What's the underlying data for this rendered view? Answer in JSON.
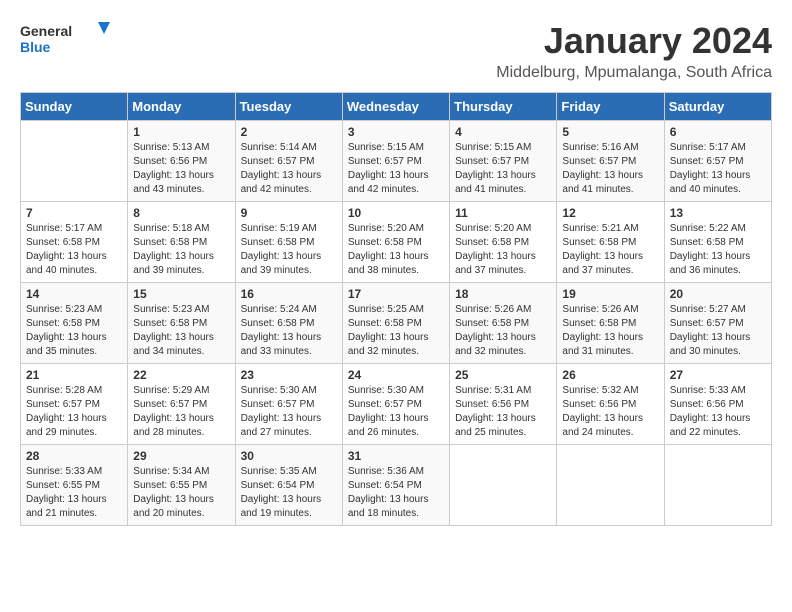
{
  "header": {
    "logo_general": "General",
    "logo_blue": "Blue",
    "month_title": "January 2024",
    "location": "Middelburg, Mpumalanga, South Africa"
  },
  "weekdays": [
    "Sunday",
    "Monday",
    "Tuesday",
    "Wednesday",
    "Thursday",
    "Friday",
    "Saturday"
  ],
  "weeks": [
    [
      {
        "day": "",
        "sunrise": "",
        "sunset": "",
        "daylight": ""
      },
      {
        "day": "1",
        "sunrise": "Sunrise: 5:13 AM",
        "sunset": "Sunset: 6:56 PM",
        "daylight": "Daylight: 13 hours and 43 minutes."
      },
      {
        "day": "2",
        "sunrise": "Sunrise: 5:14 AM",
        "sunset": "Sunset: 6:57 PM",
        "daylight": "Daylight: 13 hours and 42 minutes."
      },
      {
        "day": "3",
        "sunrise": "Sunrise: 5:15 AM",
        "sunset": "Sunset: 6:57 PM",
        "daylight": "Daylight: 13 hours and 42 minutes."
      },
      {
        "day": "4",
        "sunrise": "Sunrise: 5:15 AM",
        "sunset": "Sunset: 6:57 PM",
        "daylight": "Daylight: 13 hours and 41 minutes."
      },
      {
        "day": "5",
        "sunrise": "Sunrise: 5:16 AM",
        "sunset": "Sunset: 6:57 PM",
        "daylight": "Daylight: 13 hours and 41 minutes."
      },
      {
        "day": "6",
        "sunrise": "Sunrise: 5:17 AM",
        "sunset": "Sunset: 6:57 PM",
        "daylight": "Daylight: 13 hours and 40 minutes."
      }
    ],
    [
      {
        "day": "7",
        "sunrise": "Sunrise: 5:17 AM",
        "sunset": "Sunset: 6:58 PM",
        "daylight": "Daylight: 13 hours and 40 minutes."
      },
      {
        "day": "8",
        "sunrise": "Sunrise: 5:18 AM",
        "sunset": "Sunset: 6:58 PM",
        "daylight": "Daylight: 13 hours and 39 minutes."
      },
      {
        "day": "9",
        "sunrise": "Sunrise: 5:19 AM",
        "sunset": "Sunset: 6:58 PM",
        "daylight": "Daylight: 13 hours and 39 minutes."
      },
      {
        "day": "10",
        "sunrise": "Sunrise: 5:20 AM",
        "sunset": "Sunset: 6:58 PM",
        "daylight": "Daylight: 13 hours and 38 minutes."
      },
      {
        "day": "11",
        "sunrise": "Sunrise: 5:20 AM",
        "sunset": "Sunset: 6:58 PM",
        "daylight": "Daylight: 13 hours and 37 minutes."
      },
      {
        "day": "12",
        "sunrise": "Sunrise: 5:21 AM",
        "sunset": "Sunset: 6:58 PM",
        "daylight": "Daylight: 13 hours and 37 minutes."
      },
      {
        "day": "13",
        "sunrise": "Sunrise: 5:22 AM",
        "sunset": "Sunset: 6:58 PM",
        "daylight": "Daylight: 13 hours and 36 minutes."
      }
    ],
    [
      {
        "day": "14",
        "sunrise": "Sunrise: 5:23 AM",
        "sunset": "Sunset: 6:58 PM",
        "daylight": "Daylight: 13 hours and 35 minutes."
      },
      {
        "day": "15",
        "sunrise": "Sunrise: 5:23 AM",
        "sunset": "Sunset: 6:58 PM",
        "daylight": "Daylight: 13 hours and 34 minutes."
      },
      {
        "day": "16",
        "sunrise": "Sunrise: 5:24 AM",
        "sunset": "Sunset: 6:58 PM",
        "daylight": "Daylight: 13 hours and 33 minutes."
      },
      {
        "day": "17",
        "sunrise": "Sunrise: 5:25 AM",
        "sunset": "Sunset: 6:58 PM",
        "daylight": "Daylight: 13 hours and 32 minutes."
      },
      {
        "day": "18",
        "sunrise": "Sunrise: 5:26 AM",
        "sunset": "Sunset: 6:58 PM",
        "daylight": "Daylight: 13 hours and 32 minutes."
      },
      {
        "day": "19",
        "sunrise": "Sunrise: 5:26 AM",
        "sunset": "Sunset: 6:58 PM",
        "daylight": "Daylight: 13 hours and 31 minutes."
      },
      {
        "day": "20",
        "sunrise": "Sunrise: 5:27 AM",
        "sunset": "Sunset: 6:57 PM",
        "daylight": "Daylight: 13 hours and 30 minutes."
      }
    ],
    [
      {
        "day": "21",
        "sunrise": "Sunrise: 5:28 AM",
        "sunset": "Sunset: 6:57 PM",
        "daylight": "Daylight: 13 hours and 29 minutes."
      },
      {
        "day": "22",
        "sunrise": "Sunrise: 5:29 AM",
        "sunset": "Sunset: 6:57 PM",
        "daylight": "Daylight: 13 hours and 28 minutes."
      },
      {
        "day": "23",
        "sunrise": "Sunrise: 5:30 AM",
        "sunset": "Sunset: 6:57 PM",
        "daylight": "Daylight: 13 hours and 27 minutes."
      },
      {
        "day": "24",
        "sunrise": "Sunrise: 5:30 AM",
        "sunset": "Sunset: 6:57 PM",
        "daylight": "Daylight: 13 hours and 26 minutes."
      },
      {
        "day": "25",
        "sunrise": "Sunrise: 5:31 AM",
        "sunset": "Sunset: 6:56 PM",
        "daylight": "Daylight: 13 hours and 25 minutes."
      },
      {
        "day": "26",
        "sunrise": "Sunrise: 5:32 AM",
        "sunset": "Sunset: 6:56 PM",
        "daylight": "Daylight: 13 hours and 24 minutes."
      },
      {
        "day": "27",
        "sunrise": "Sunrise: 5:33 AM",
        "sunset": "Sunset: 6:56 PM",
        "daylight": "Daylight: 13 hours and 22 minutes."
      }
    ],
    [
      {
        "day": "28",
        "sunrise": "Sunrise: 5:33 AM",
        "sunset": "Sunset: 6:55 PM",
        "daylight": "Daylight: 13 hours and 21 minutes."
      },
      {
        "day": "29",
        "sunrise": "Sunrise: 5:34 AM",
        "sunset": "Sunset: 6:55 PM",
        "daylight": "Daylight: 13 hours and 20 minutes."
      },
      {
        "day": "30",
        "sunrise": "Sunrise: 5:35 AM",
        "sunset": "Sunset: 6:54 PM",
        "daylight": "Daylight: 13 hours and 19 minutes."
      },
      {
        "day": "31",
        "sunrise": "Sunrise: 5:36 AM",
        "sunset": "Sunset: 6:54 PM",
        "daylight": "Daylight: 13 hours and 18 minutes."
      },
      {
        "day": "",
        "sunrise": "",
        "sunset": "",
        "daylight": ""
      },
      {
        "day": "",
        "sunrise": "",
        "sunset": "",
        "daylight": ""
      },
      {
        "day": "",
        "sunrise": "",
        "sunset": "",
        "daylight": ""
      }
    ]
  ]
}
